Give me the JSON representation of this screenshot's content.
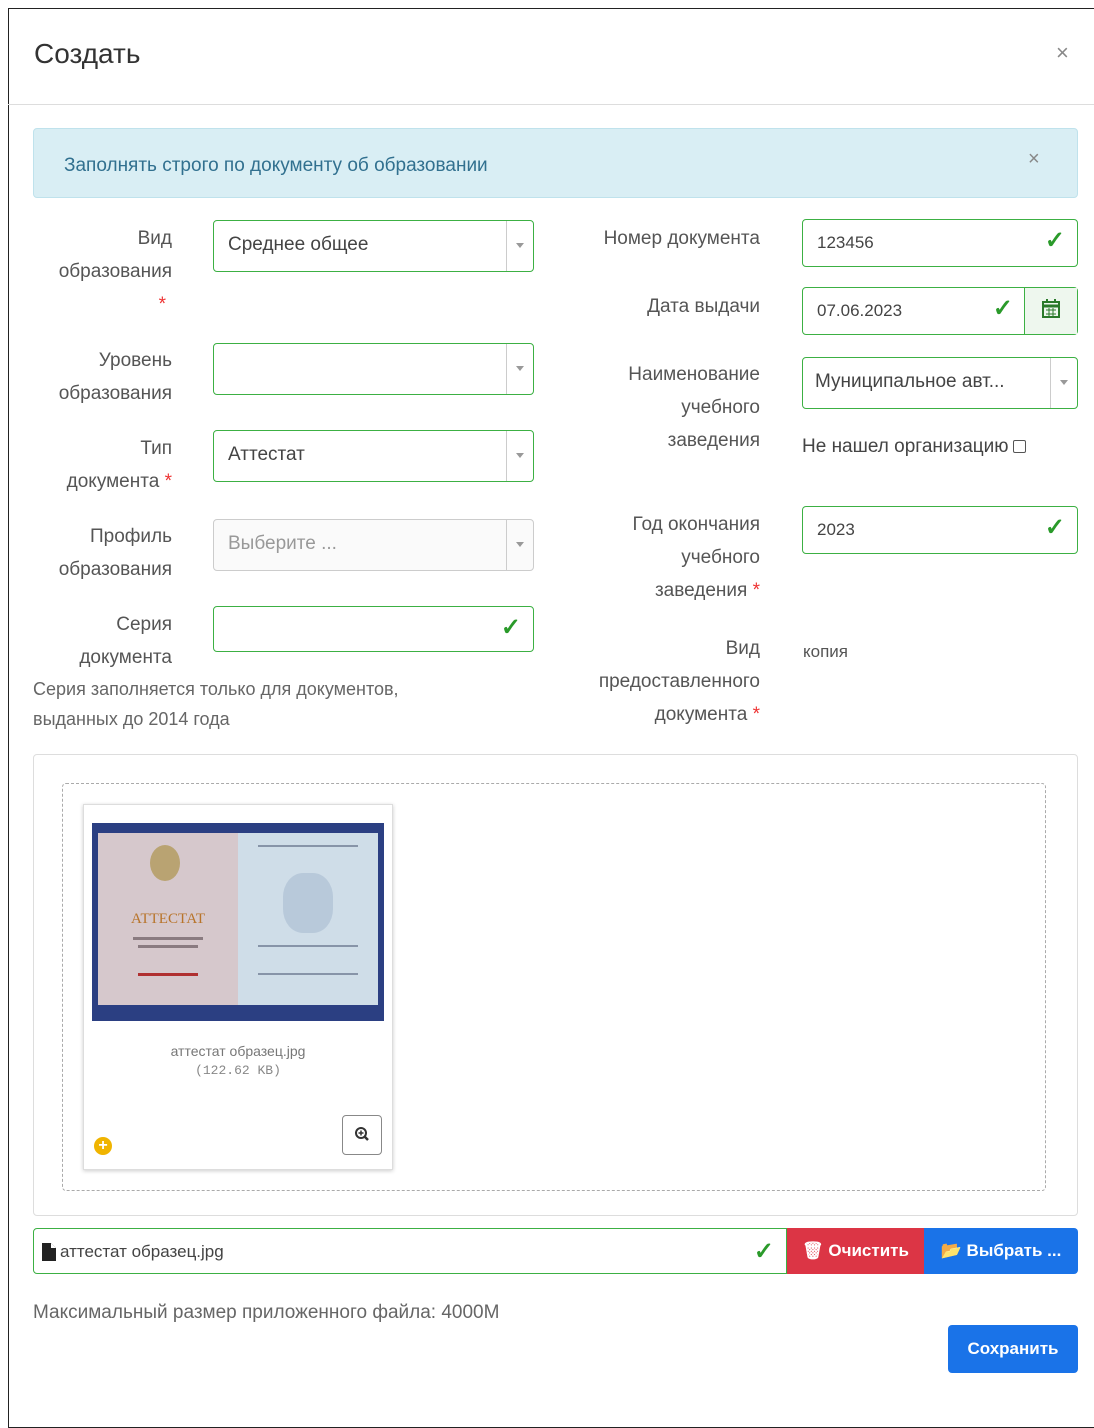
{
  "modal": {
    "title": "Создать",
    "close_symbol": "×"
  },
  "alert": {
    "text": "Заполнять строго по документу об образовании",
    "close_symbol": "×"
  },
  "left_fields": [
    {
      "label_lines": [
        "Вид",
        "образования"
      ],
      "value": "Среднее общее",
      "required": true
    },
    {
      "label_lines": [
        "Уровень",
        "образования"
      ],
      "value": ""
    },
    {
      "label_lines": [
        "Тип",
        "документа"
      ],
      "value": "Аттестат",
      "required": true
    },
    {
      "label_lines": [
        "Профиль",
        "образования"
      ],
      "placeholder": "Выберите ..."
    },
    {
      "label_lines": [
        "Серия",
        "документа"
      ],
      "value": ""
    }
  ],
  "series_note_lines": [
    "Серия заполняется только для документов,",
    "выданных до 2014 года"
  ],
  "right_fields": {
    "doc_number": {
      "label": "Номер документа",
      "value": "123456"
    },
    "issue_date": {
      "label": "Дата выдачи",
      "value": "07.06.2023"
    },
    "institution": {
      "label_lines": [
        "Наименование",
        "учебного",
        "заведения"
      ],
      "value": "Муниципальное авт..."
    },
    "not_found": {
      "label": "Не нашел организацию"
    },
    "grad_year": {
      "label_lines": [
        "Год окончания",
        "учебного",
        "заведения"
      ],
      "value": "2023",
      "required": true
    },
    "doc_type_provided": {
      "label_lines": [
        "Вид",
        "предоставленного",
        "документа"
      ],
      "value": "копия",
      "required": true
    }
  },
  "upload": {
    "preview": {
      "filename": "аттестат образец.jpg",
      "filesize": "(122.62 KB)",
      "doc_heading": "АТТЕСТАТ"
    },
    "file_input_value": "аттестат образец.jpg",
    "clear_button": "Очистить",
    "browse_button": "Выбрать ...",
    "max_size_note": "Максимальный размер приложенного файла: 4000M"
  },
  "save_button": "Сохранить",
  "colors": {
    "valid": "#3cb043",
    "primary": "#1a73e8",
    "danger": "#dc3545",
    "alert_bg": "#d9eef4"
  }
}
